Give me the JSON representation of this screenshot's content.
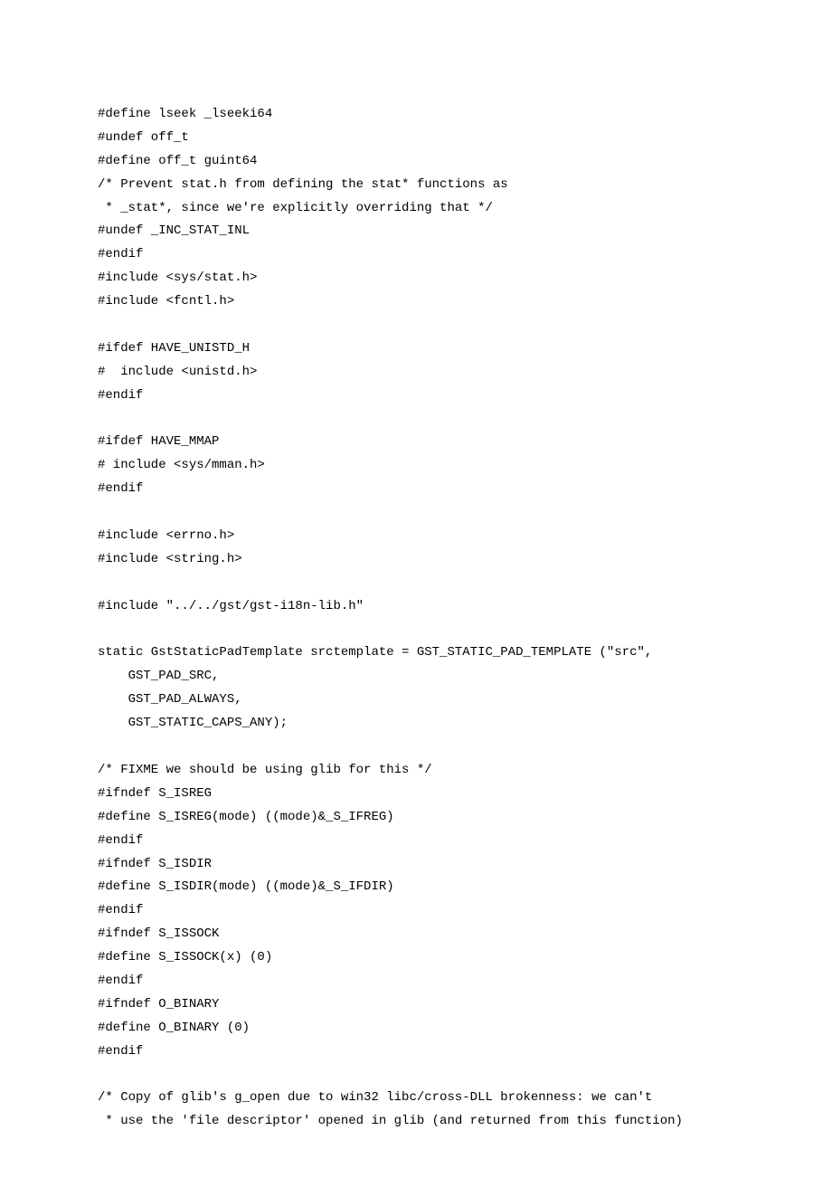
{
  "lines": [
    "#define lseek _lseeki64",
    "#undef off_t",
    "#define off_t guint64",
    "/* Prevent stat.h from defining the stat* functions as",
    " * _stat*, since we're explicitly overriding that */",
    "#undef _INC_STAT_INL",
    "#endif",
    "#include <sys/stat.h>",
    "#include <fcntl.h>",
    "",
    "#ifdef HAVE_UNISTD_H",
    "#  include <unistd.h>",
    "#endif",
    "",
    "#ifdef HAVE_MMAP",
    "# include <sys/mman.h>",
    "#endif",
    "",
    "#include <errno.h>",
    "#include <string.h>",
    "",
    "#include \"../../gst/gst-i18n-lib.h\"",
    "",
    "static GstStaticPadTemplate srctemplate = GST_STATIC_PAD_TEMPLATE (\"src\",",
    "    GST_PAD_SRC,",
    "    GST_PAD_ALWAYS,",
    "    GST_STATIC_CAPS_ANY);",
    "",
    "/* FIXME we should be using glib for this */",
    "#ifndef S_ISREG",
    "#define S_ISREG(mode) ((mode)&_S_IFREG)",
    "#endif",
    "#ifndef S_ISDIR",
    "#define S_ISDIR(mode) ((mode)&_S_IFDIR)",
    "#endif",
    "#ifndef S_ISSOCK",
    "#define S_ISSOCK(x) (0)",
    "#endif",
    "#ifndef O_BINARY",
    "#define O_BINARY (0)",
    "#endif",
    "",
    "/* Copy of glib's g_open due to win32 libc/cross-DLL brokenness: we can't",
    " * use the 'file descriptor' opened in glib (and returned from this function)"
  ]
}
